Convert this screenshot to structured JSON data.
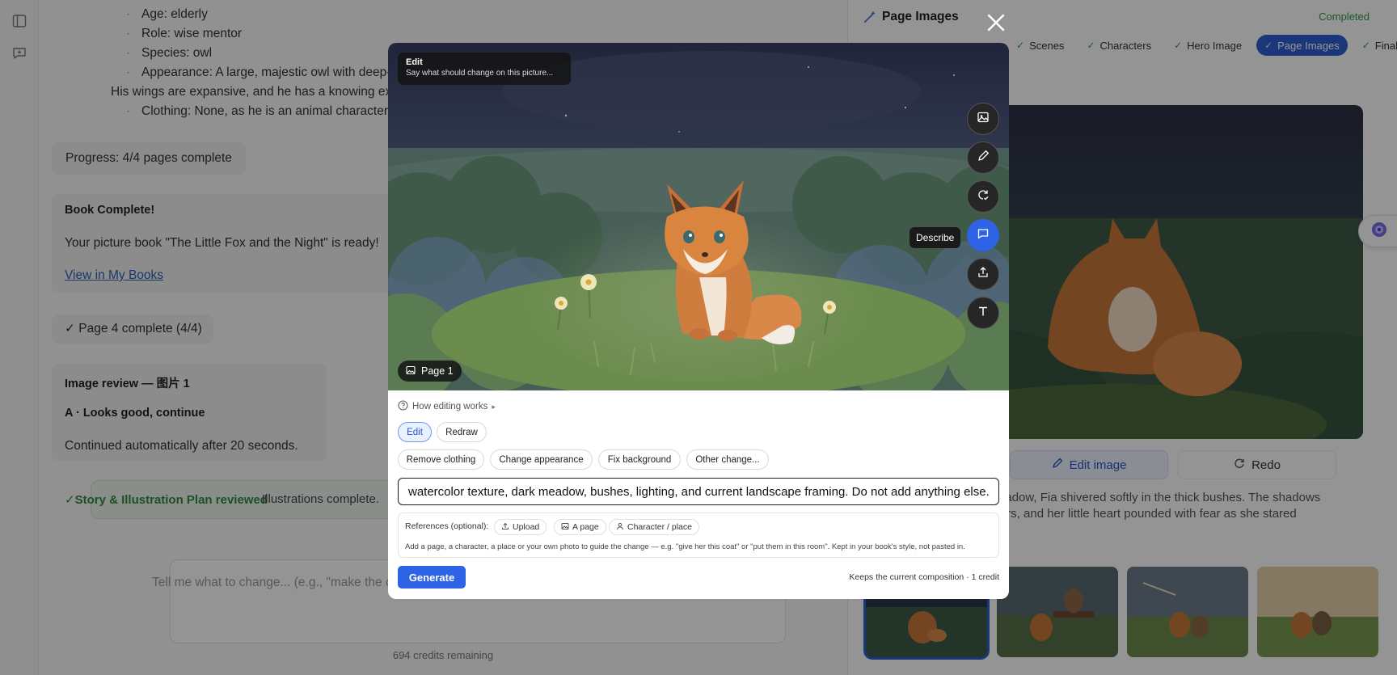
{
  "chat": {
    "details": [
      "Age: elderly",
      "Role: wise mentor",
      "Species: owl",
      "Appearance: A large, majestic owl with deep-set eyes",
      "His wings are expansive, and he has a knowing expressi",
      "Clothing: None, as he is an animal character. His feath"
    ],
    "progress": "Progress: 4/4 pages complete",
    "book_complete_title": "Book Complete!",
    "book_ready": "Your picture book \"The Little Fox and the Night\" is ready!",
    "view_link": "View in My Books",
    "page_complete": "✓ Page 4 complete (4/4)",
    "review_title": "Image review — 图片 1",
    "review_choice": "A · Looks good, continue",
    "review_note": "Continued automatically after 20 seconds.",
    "plan_title": "✓Story & Illustration Plan reviewed",
    "plan_note": "Illustrations complete.",
    "input_placeholder": "Tell me what to change... (e.g., \"make the ch",
    "credits": "694 credits remaining"
  },
  "panel": {
    "title": "Page Images",
    "status": "Completed",
    "steps": [
      "Scenes",
      "Characters",
      "Hero Image",
      "Page Images",
      "Final"
    ],
    "active_step": "Page Images",
    "actions": {
      "edit": "Edit image",
      "redo": "Redo"
    },
    "story_lines": [
      "ess meadow, Fia shivered softly in the thick bushes. The shadows",
      "monsters, and her little heart pounded with fear as she stared"
    ]
  },
  "modal": {
    "tip_title": "Edit",
    "tip_text": "Say what should change on this picture...",
    "describe_tooltip": "Describe",
    "page_label": "Page 1",
    "how_link": "How editing works",
    "modes": [
      "Edit",
      "Redraw"
    ],
    "active_mode": "Edit",
    "quick_actions": [
      "Remove clothing",
      "Change appearance",
      "Fix background",
      "Other change..."
    ],
    "instruction": "watercolor texture, dark meadow, bushes, lighting, and current landscape framing. Do not add anything else.",
    "refs_label": "References (optional):",
    "ref_buttons": [
      "Upload",
      "A page",
      "Character / place"
    ],
    "refs_hint": "Add a page, a character, a place or your own photo to guide the change — e.g. \"give her this coat\" or \"put them in this room\". Kept in your book's style, not pasted in.",
    "generate": "Generate",
    "keeps": "Keeps the current composition · 1 credit"
  },
  "colors": {
    "accent": "#2e63e6",
    "success": "#2f9a45"
  }
}
